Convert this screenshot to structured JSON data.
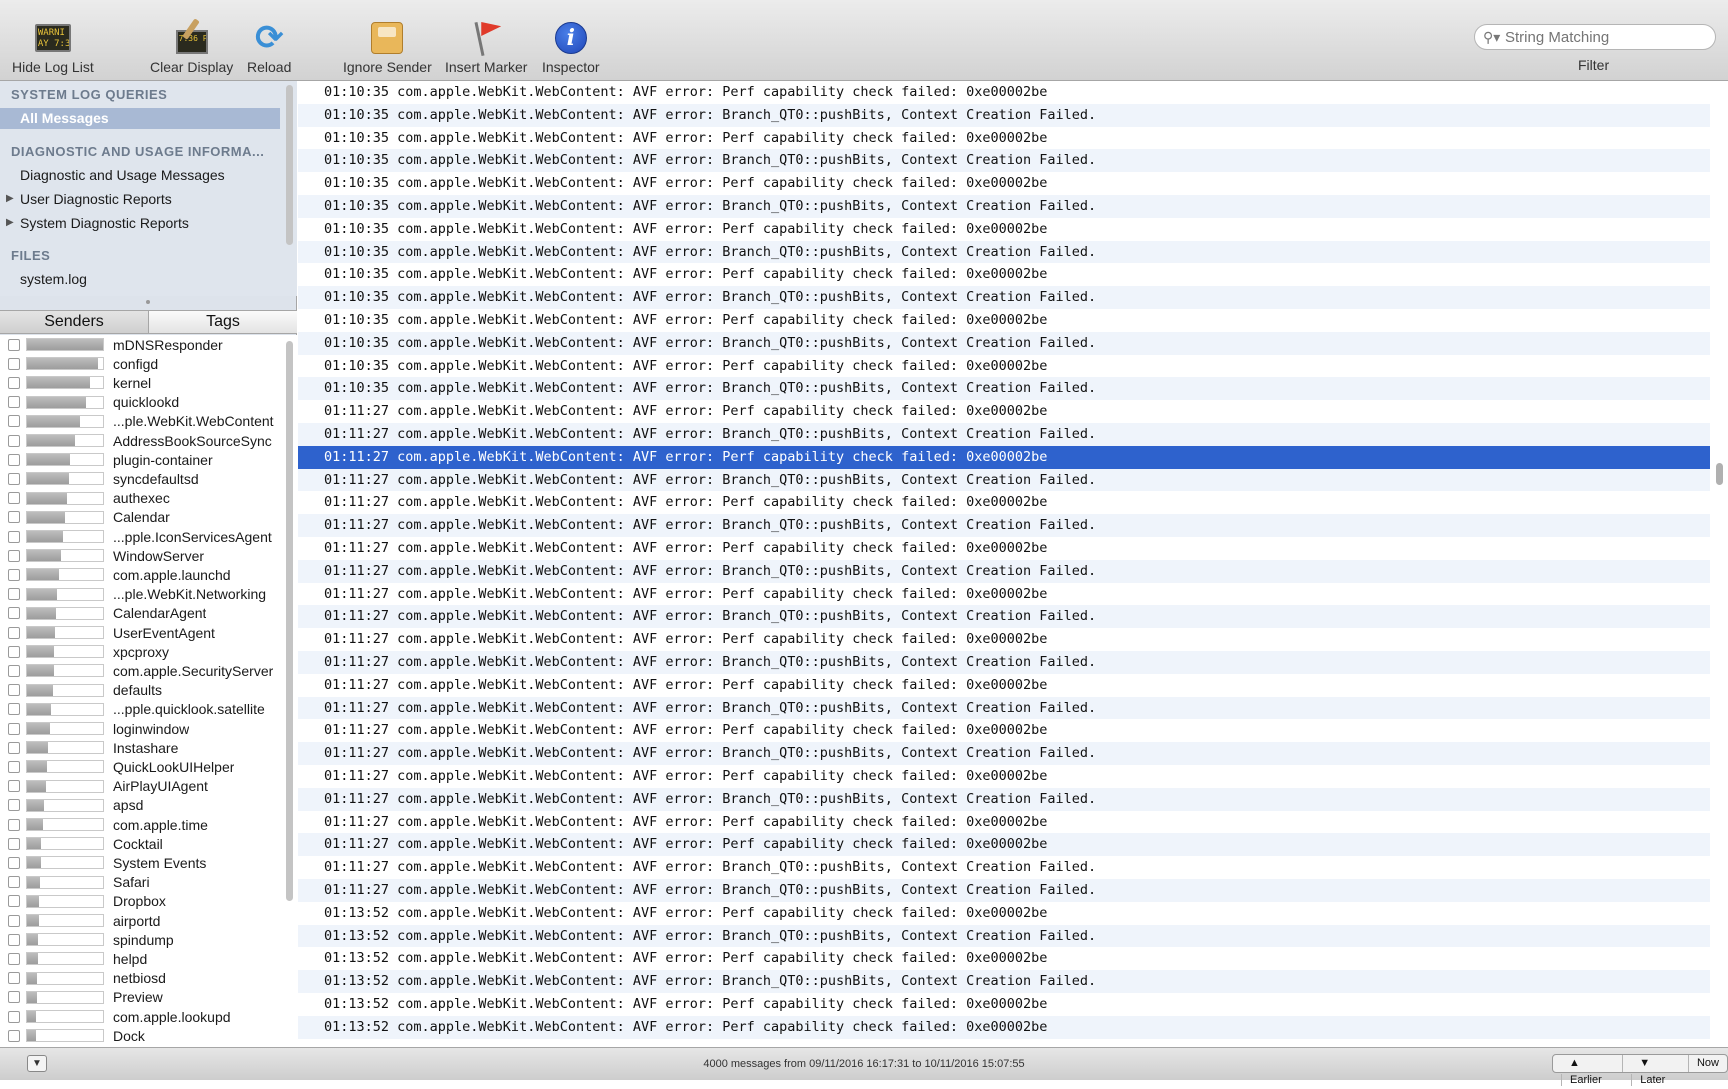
{
  "toolbar": {
    "hide_log_list": "Hide Log List",
    "clear_display": "Clear Display",
    "reload": "Reload",
    "ignore_sender": "Ignore Sender",
    "insert_marker": "Insert Marker",
    "inspector": "Inspector",
    "search_placeholder": "String Matching",
    "filter_label": "Filter",
    "console_icon_text": "WARNI\nAY 7:36",
    "clear_icon_text": "7:36 P"
  },
  "sidebar": {
    "system_log_queries": "SYSTEM LOG QUERIES",
    "all_messages": "All Messages",
    "diagnostic_header": "DIAGNOSTIC AND USAGE INFORMA...",
    "diagnostic_messages": "Diagnostic and Usage Messages",
    "user_reports": "User Diagnostic Reports",
    "system_reports": "System Diagnostic Reports",
    "files_header": "FILES",
    "system_log": "system.log"
  },
  "tabs": {
    "senders": "Senders",
    "tags": "Tags",
    "active": "senders"
  },
  "senders": [
    {
      "name": "mDNSResponder",
      "level": 1.0
    },
    {
      "name": "configd",
      "level": 0.93
    },
    {
      "name": "kernel",
      "level": 0.83
    },
    {
      "name": "quicklookd",
      "level": 0.77
    },
    {
      "name": "...ple.WebKit.WebContent",
      "level": 0.7
    },
    {
      "name": "AddressBookSourceSync",
      "level": 0.63
    },
    {
      "name": "plugin-container",
      "level": 0.57
    },
    {
      "name": "syncdefaultsd",
      "level": 0.55
    },
    {
      "name": "authexec",
      "level": 0.53
    },
    {
      "name": "Calendar",
      "level": 0.5
    },
    {
      "name": "...pple.IconServicesAgent",
      "level": 0.47
    },
    {
      "name": "WindowServer",
      "level": 0.45
    },
    {
      "name": "com.apple.launchd",
      "level": 0.42
    },
    {
      "name": "...ple.WebKit.Networking",
      "level": 0.4
    },
    {
      "name": "CalendarAgent",
      "level": 0.38
    },
    {
      "name": "UserEventAgent",
      "level": 0.37
    },
    {
      "name": "xpcproxy",
      "level": 0.36
    },
    {
      "name": "com.apple.SecurityServer",
      "level": 0.35
    },
    {
      "name": "defaults",
      "level": 0.34
    },
    {
      "name": "...pple.quicklook.satellite",
      "level": 0.32
    },
    {
      "name": "loginwindow",
      "level": 0.3
    },
    {
      "name": "Instashare",
      "level": 0.28
    },
    {
      "name": "QuickLookUIHelper",
      "level": 0.26
    },
    {
      "name": "AirPlayUIAgent",
      "level": 0.25
    },
    {
      "name": "apsd",
      "level": 0.23
    },
    {
      "name": "com.apple.time",
      "level": 0.21
    },
    {
      "name": "Cocktail",
      "level": 0.19
    },
    {
      "name": "System Events",
      "level": 0.18
    },
    {
      "name": "Safari",
      "level": 0.17
    },
    {
      "name": "Dropbox",
      "level": 0.16
    },
    {
      "name": "airportd",
      "level": 0.16
    },
    {
      "name": "spindump",
      "level": 0.15
    },
    {
      "name": "helpd",
      "level": 0.14
    },
    {
      "name": "netbiosd",
      "level": 0.13
    },
    {
      "name": "Preview",
      "level": 0.13
    },
    {
      "name": "com.apple.lookupd",
      "level": 0.12
    },
    {
      "name": "Dock",
      "level": 0.12
    }
  ],
  "log": [
    "01:10:35 com.apple.WebKit.WebContent: AVF error: Perf capability check failed: 0xe00002be",
    "01:10:35 com.apple.WebKit.WebContent: AVF error: Branch_QT0::pushBits, Context Creation Failed.",
    "01:10:35 com.apple.WebKit.WebContent: AVF error: Perf capability check failed: 0xe00002be",
    "01:10:35 com.apple.WebKit.WebContent: AVF error: Branch_QT0::pushBits, Context Creation Failed.",
    "01:10:35 com.apple.WebKit.WebContent: AVF error: Perf capability check failed: 0xe00002be",
    "01:10:35 com.apple.WebKit.WebContent: AVF error: Branch_QT0::pushBits, Context Creation Failed.",
    "01:10:35 com.apple.WebKit.WebContent: AVF error: Perf capability check failed: 0xe00002be",
    "01:10:35 com.apple.WebKit.WebContent: AVF error: Branch_QT0::pushBits, Context Creation Failed.",
    "01:10:35 com.apple.WebKit.WebContent: AVF error: Perf capability check failed: 0xe00002be",
    "01:10:35 com.apple.WebKit.WebContent: AVF error: Branch_QT0::pushBits, Context Creation Failed.",
    "01:10:35 com.apple.WebKit.WebContent: AVF error: Perf capability check failed: 0xe00002be",
    "01:10:35 com.apple.WebKit.WebContent: AVF error: Branch_QT0::pushBits, Context Creation Failed.",
    "01:10:35 com.apple.WebKit.WebContent: AVF error: Perf capability check failed: 0xe00002be",
    "01:10:35 com.apple.WebKit.WebContent: AVF error: Branch_QT0::pushBits, Context Creation Failed.",
    "01:11:27 com.apple.WebKit.WebContent: AVF error: Perf capability check failed: 0xe00002be",
    "01:11:27 com.apple.WebKit.WebContent: AVF error: Branch_QT0::pushBits, Context Creation Failed.",
    "01:11:27 com.apple.WebKit.WebContent: AVF error: Perf capability check failed: 0xe00002be",
    "01:11:27 com.apple.WebKit.WebContent: AVF error: Branch_QT0::pushBits, Context Creation Failed.",
    "01:11:27 com.apple.WebKit.WebContent: AVF error: Perf capability check failed: 0xe00002be",
    "01:11:27 com.apple.WebKit.WebContent: AVF error: Branch_QT0::pushBits, Context Creation Failed.",
    "01:11:27 com.apple.WebKit.WebContent: AVF error: Perf capability check failed: 0xe00002be",
    "01:11:27 com.apple.WebKit.WebContent: AVF error: Branch_QT0::pushBits, Context Creation Failed.",
    "01:11:27 com.apple.WebKit.WebContent: AVF error: Perf capability check failed: 0xe00002be",
    "01:11:27 com.apple.WebKit.WebContent: AVF error: Branch_QT0::pushBits, Context Creation Failed.",
    "01:11:27 com.apple.WebKit.WebContent: AVF error: Perf capability check failed: 0xe00002be",
    "01:11:27 com.apple.WebKit.WebContent: AVF error: Branch_QT0::pushBits, Context Creation Failed.",
    "01:11:27 com.apple.WebKit.WebContent: AVF error: Perf capability check failed: 0xe00002be",
    "01:11:27 com.apple.WebKit.WebContent: AVF error: Branch_QT0::pushBits, Context Creation Failed.",
    "01:11:27 com.apple.WebKit.WebContent: AVF error: Perf capability check failed: 0xe00002be",
    "01:11:27 com.apple.WebKit.WebContent: AVF error: Branch_QT0::pushBits, Context Creation Failed.",
    "01:11:27 com.apple.WebKit.WebContent: AVF error: Perf capability check failed: 0xe00002be",
    "01:11:27 com.apple.WebKit.WebContent: AVF error: Branch_QT0::pushBits, Context Creation Failed.",
    "01:11:27 com.apple.WebKit.WebContent: AVF error: Perf capability check failed: 0xe00002be",
    "01:11:27 com.apple.WebKit.WebContent: AVF error: Perf capability check failed: 0xe00002be",
    "01:11:27 com.apple.WebKit.WebContent: AVF error: Branch_QT0::pushBits, Context Creation Failed.",
    "01:11:27 com.apple.WebKit.WebContent: AVF error: Branch_QT0::pushBits, Context Creation Failed.",
    "01:13:52 com.apple.WebKit.WebContent: AVF error: Perf capability check failed: 0xe00002be",
    "01:13:52 com.apple.WebKit.WebContent: AVF error: Branch_QT0::pushBits, Context Creation Failed.",
    "01:13:52 com.apple.WebKit.WebContent: AVF error: Perf capability check failed: 0xe00002be",
    "01:13:52 com.apple.WebKit.WebContent: AVF error: Branch_QT0::pushBits, Context Creation Failed.",
    "01:13:52 com.apple.WebKit.WebContent: AVF error: Perf capability check failed: 0xe00002be",
    "01:13:52 com.apple.WebKit.WebContent: AVF error: Perf capability check failed: 0xe00002be"
  ],
  "selected_log_row": 16,
  "status": {
    "summary": "4000 messages from 09/11/2016 16:17:31 to 10/11/2016 15:07:55",
    "earlier": "Earlier",
    "later": "Later",
    "now": "Now"
  },
  "colors": {
    "selection": "#2e62cd",
    "alt_row": "#eff4fb",
    "sidebar_bg": "#dfe5ed",
    "section_header": "#6d7b8d"
  }
}
